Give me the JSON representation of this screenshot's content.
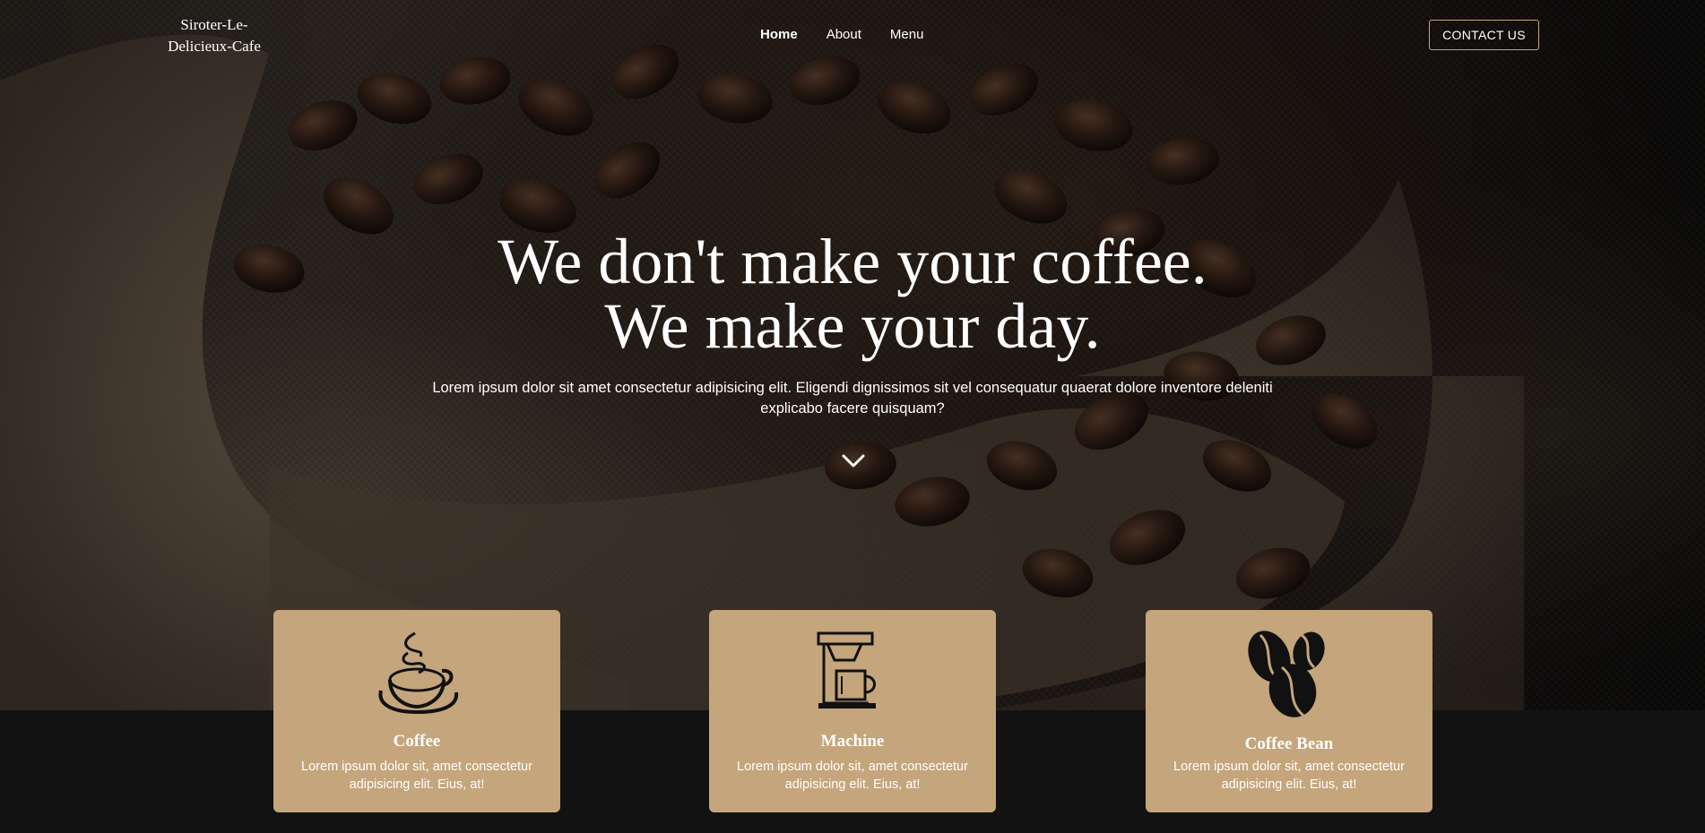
{
  "header": {
    "logo": "Siroter-Le-\nDelicieux-Cafe",
    "nav": [
      {
        "label": "Home",
        "active": true
      },
      {
        "label": "About",
        "active": false
      },
      {
        "label": "Menu",
        "active": false
      }
    ],
    "contact_button": "CONTACT US"
  },
  "hero": {
    "headline_line1": "We don't make your coffee.",
    "headline_line2": "We make your day.",
    "subtitle": "Lorem ipsum dolor sit amet consectetur adipisicing elit. Eligendi dignissimos sit vel consequatur quaerat dolore inventore deleniti explicabo facere quisquam?",
    "scroll_icon": "chevron-down-icon"
  },
  "cards": [
    {
      "title": "Coffee",
      "text": "Lorem ipsum dolor sit, amet consectetur adipisicing elit. Eius, at!",
      "icon": "coffee-cup-icon"
    },
    {
      "title": "Machine",
      "text": "Lorem ipsum dolor sit, amet consectetur adipisicing elit. Eius, at!",
      "icon": "coffee-machine-icon"
    },
    {
      "title": "Coffee Bean",
      "text": "Lorem ipsum dolor sit, amet consectetur adipisicing elit. Eius, at!",
      "icon": "coffee-bean-icon"
    }
  ],
  "colors": {
    "accent": "#c4a57c",
    "page_background": "#121212",
    "text": "#ffffff"
  }
}
